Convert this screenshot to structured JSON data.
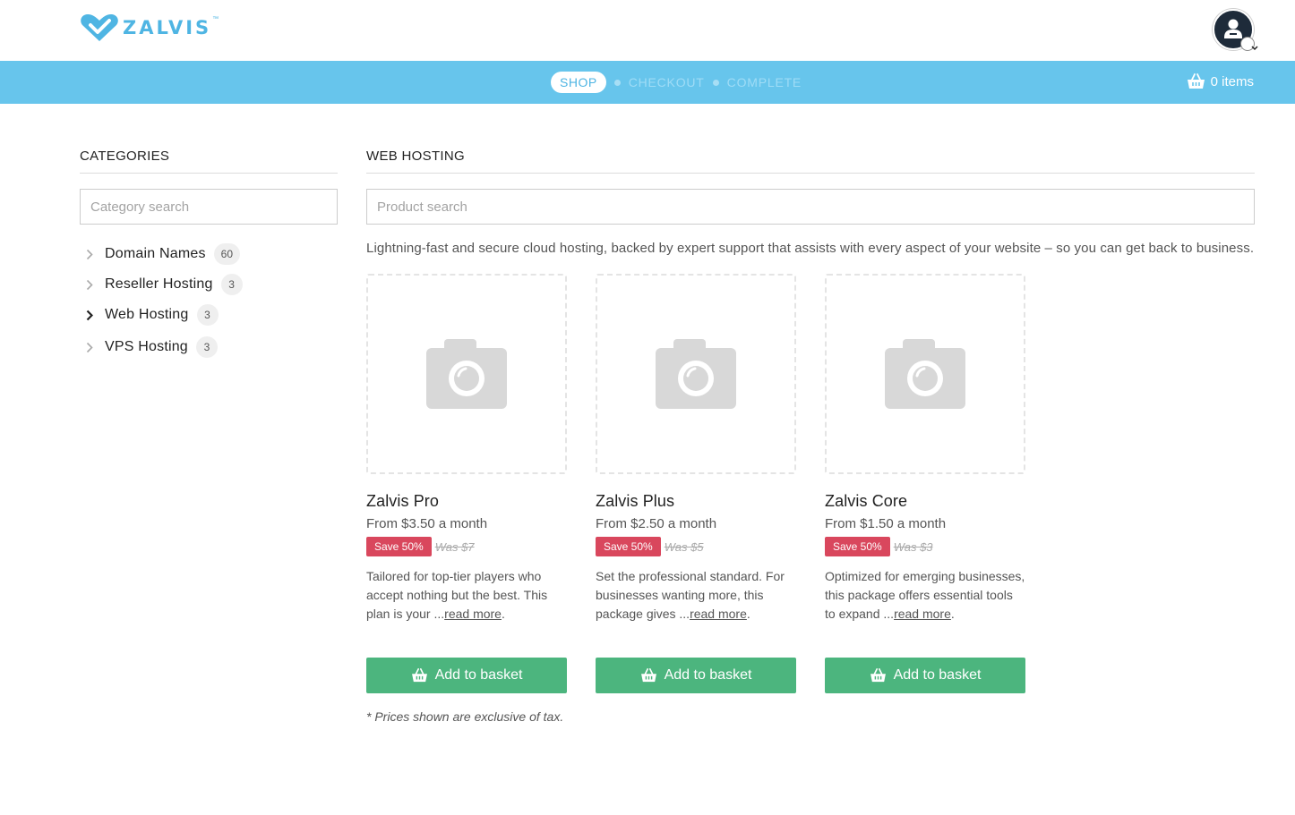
{
  "brand": {
    "name": "ZALVIS",
    "tm": "™"
  },
  "steps": {
    "shop": "SHOP",
    "checkout": "CHECKOUT",
    "complete": "COMPLETE"
  },
  "cart": {
    "label": "0 items"
  },
  "sidebar": {
    "title": "CATEGORIES",
    "search_placeholder": "Category search",
    "items": [
      {
        "label": "Domain Names",
        "count": "60"
      },
      {
        "label": "Reseller Hosting",
        "count": "3"
      },
      {
        "label": "Web Hosting",
        "count": "3"
      },
      {
        "label": "VPS Hosting",
        "count": "3"
      }
    ]
  },
  "main": {
    "title": "WEB HOSTING",
    "search_placeholder": "Product search",
    "description": "Lightning-fast and secure cloud hosting, backed by expert support that assists with every aspect of your website – so you can get back to business.",
    "products": [
      {
        "name": "Zalvis Pro",
        "price": "From $3.50 a month",
        "save": "Save 50%",
        "was": "Was $7",
        "desc": "Tailored for top-tier players who accept nothing but the best. This plan is your ...",
        "read_more": "read more",
        "button": "Add to basket"
      },
      {
        "name": "Zalvis Plus",
        "price": "From $2.50 a month",
        "save": "Save 50%",
        "was": "Was $5",
        "desc": "Set the professional standard. For businesses wanting more, this package gives ...",
        "read_more": "read more",
        "button": "Add to basket"
      },
      {
        "name": "Zalvis Core",
        "price": "From $1.50 a month",
        "save": "Save 50%",
        "was": "Was $3",
        "desc": "Optimized for emerging businesses, this package offers essential tools to expand ...",
        "read_more": "read more",
        "button": "Add to basket"
      }
    ],
    "tax_note": "* Prices shown are exclusive of tax."
  },
  "colors": {
    "accent": "#67c5ec",
    "brand": "#4fb5e3",
    "button": "#4cb57e",
    "save": "#d9475d"
  },
  "icons": {
    "logo": "heart-check-icon",
    "avatar": "user-icon",
    "cart": "basket-icon",
    "placeholder": "camera-icon"
  }
}
